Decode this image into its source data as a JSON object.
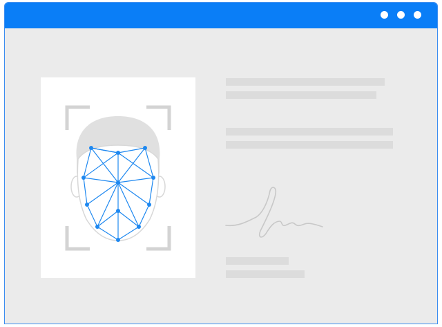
{
  "window": {
    "titlebar_color": "#0a7ef7",
    "controls": [
      "window-dot",
      "window-dot",
      "window-dot"
    ]
  },
  "document": {
    "photo": {
      "type": "face-scan",
      "mesh_color": "#1e88f0"
    },
    "text_lines": [
      "placeholder-line",
      "placeholder-line",
      "placeholder-line",
      "placeholder-line",
      "placeholder-line",
      "placeholder-line"
    ],
    "signature": "handwritten-signature"
  }
}
